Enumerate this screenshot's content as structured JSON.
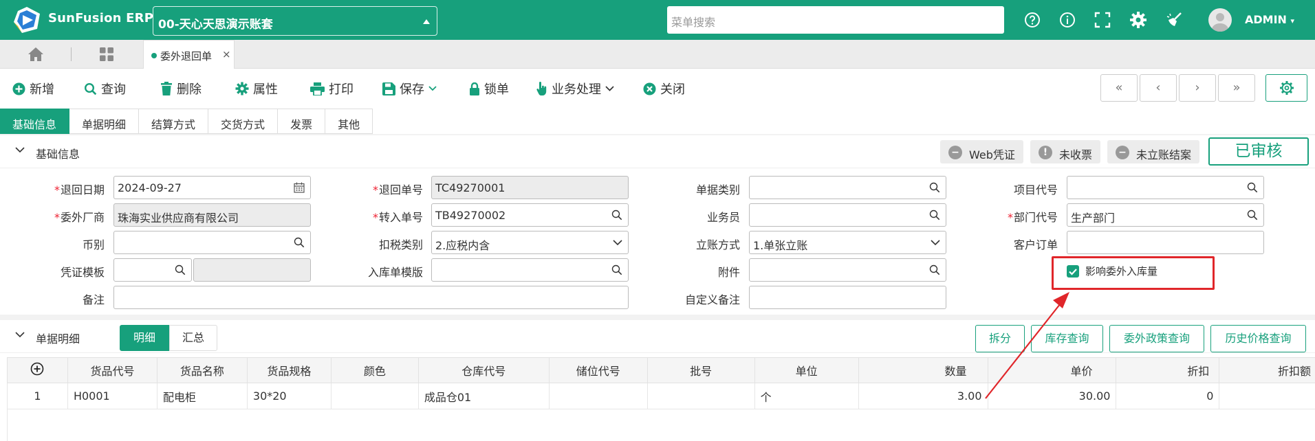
{
  "app": {
    "brand": "SunFusion ERP",
    "account": "00-天心天思演示账套",
    "search_placeholder": "菜单搜索",
    "user": "ADMIN",
    "accent": "#17a07c"
  },
  "tabs": {
    "open_tab": "委外退回单",
    "close": "×"
  },
  "toolbar": {
    "new": "新增",
    "query": "查询",
    "delete": "删除",
    "props": "属性",
    "print": "打印",
    "save": "保存",
    "lock": "锁单",
    "business": "业务处理",
    "close": "关闭",
    "first": "«",
    "prev": "‹",
    "next": "›",
    "last": "»"
  },
  "form_tabs": [
    "基础信息",
    "单据明细",
    "结算方式",
    "交货方式",
    "发票",
    "其他"
  ],
  "basic": {
    "title": "基础信息",
    "status": {
      "web_voucher": "Web凭证",
      "uncollected": "未收票",
      "unposted": "未立账结案",
      "audited": "已审核"
    },
    "fields": {
      "return_date": {
        "label": "退回日期",
        "value": "2024-09-27"
      },
      "return_no": {
        "label": "退回单号",
        "value": "TC49270001"
      },
      "doc_type": {
        "label": "单据类别",
        "value": ""
      },
      "project_code": {
        "label": "项目代号",
        "value": ""
      },
      "supplier": {
        "label": "委外厂商",
        "value": "珠海实业供应商有限公司"
      },
      "transfer_no": {
        "label": "转入单号",
        "value": "TB49270002"
      },
      "salesman": {
        "label": "业务员",
        "value": ""
      },
      "dept_code": {
        "label": "部门代号",
        "value": "生产部门"
      },
      "currency": {
        "label": "币别",
        "value": ""
      },
      "tax_type": {
        "label": "扣税类别",
        "value": "2.应税内含"
      },
      "posting": {
        "label": "立账方式",
        "value": "1.单张立账"
      },
      "customer_order": {
        "label": "客户订单",
        "value": ""
      },
      "voucher_template": {
        "label": "凭证模板",
        "value": ""
      },
      "inbound_template": {
        "label": "入库单模版",
        "value": ""
      },
      "attachment": {
        "label": "附件",
        "value": ""
      },
      "remark": {
        "label": "备注",
        "value": ""
      },
      "custom_remark": {
        "label": "自定义备注",
        "value": ""
      }
    },
    "affect_inbound": {
      "label": "影响委外入库量",
      "checked": true
    },
    "required_mark": "*"
  },
  "detail": {
    "title": "单据明细",
    "view_detail": "明细",
    "view_summary": "汇总",
    "buttons": {
      "split": "拆分",
      "stock_query": "库存查询",
      "policy_query": "委外政策查询",
      "price_history": "历史价格查询"
    },
    "columns": [
      "货品代号",
      "货品名称",
      "货品规格",
      "颜色",
      "仓库代号",
      "储位代号",
      "批号",
      "单位",
      "数量",
      "单价",
      "折扣",
      "折扣额"
    ],
    "rows": [
      {
        "idx": "1",
        "code": "H0001",
        "name": "配电柜",
        "spec": "30*20",
        "color": "",
        "wh": "成品仓01",
        "loc": "",
        "lot": "",
        "unit": "个",
        "qty": "3.00",
        "price": "30.00",
        "discount": "0",
        "disc_amt": ""
      }
    ]
  }
}
